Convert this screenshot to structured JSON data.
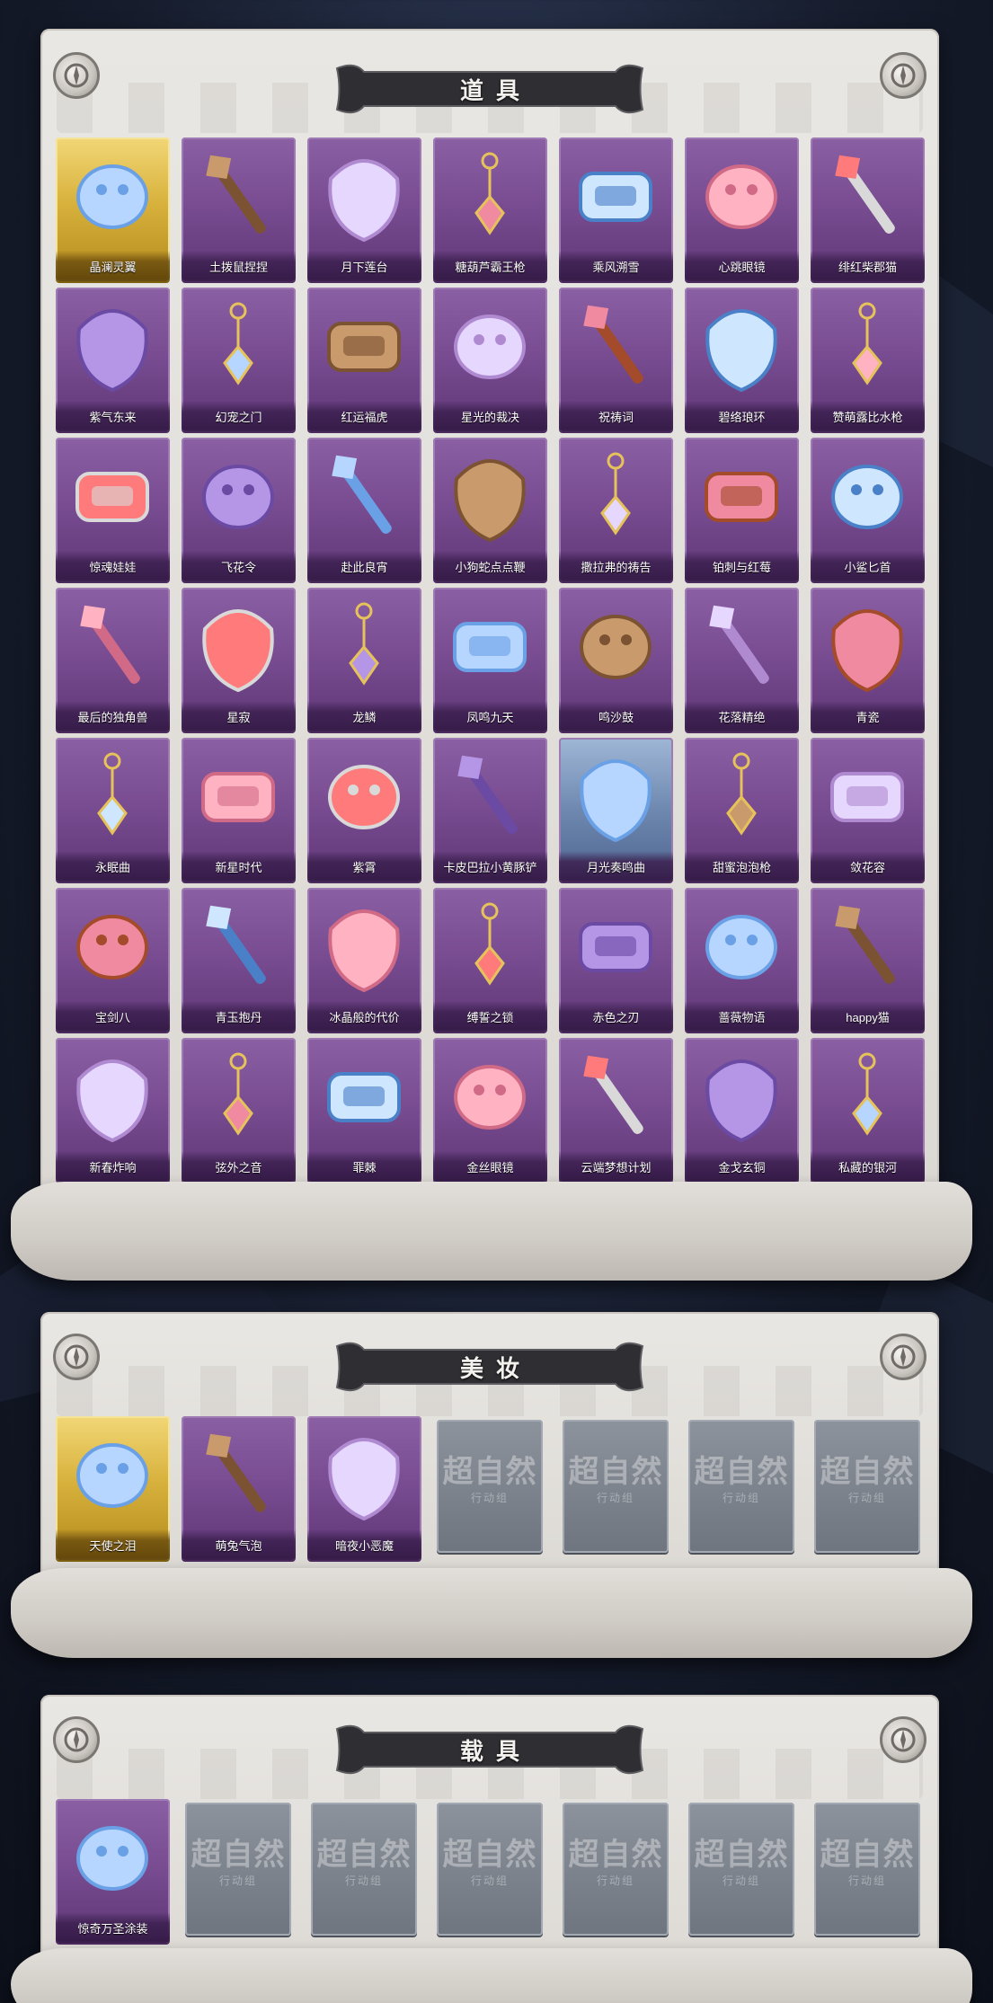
{
  "sections": {
    "props": {
      "title": "道具",
      "items": [
        {
          "label": "晶澜灵翼",
          "rarity": "gold",
          "icon": "crystal-wings-icon"
        },
        {
          "label": "土拨鼠捏捏",
          "rarity": "purple",
          "icon": "marmot-plush-icon"
        },
        {
          "label": "月下莲台",
          "rarity": "purple",
          "icon": "lotus-pendant-icon"
        },
        {
          "label": "糖葫芦霸王枪",
          "rarity": "purple",
          "icon": "candy-spear-icon"
        },
        {
          "label": "乘风溯雪",
          "rarity": "purple",
          "icon": "jetpack-icon"
        },
        {
          "label": "心跳眼镜",
          "rarity": "purple",
          "icon": "heart-glasses-icon"
        },
        {
          "label": "绯红柴郡猫",
          "rarity": "purple",
          "icon": "cheshire-cat-icon"
        },
        {
          "label": "紫气东来",
          "rarity": "purple",
          "icon": "purple-blade-icon"
        },
        {
          "label": "幻宠之门",
          "rarity": "purple",
          "icon": "pet-device-icon"
        },
        {
          "label": "红运福虎",
          "rarity": "purple",
          "icon": "tiger-plush-icon"
        },
        {
          "label": "星光的裁决",
          "rarity": "purple",
          "icon": "star-rifle-icon"
        },
        {
          "label": "祝祷词",
          "rarity": "purple",
          "icon": "cross-necklace-icon"
        },
        {
          "label": "碧络琅环",
          "rarity": "purple",
          "icon": "jade-sword-icon"
        },
        {
          "label": "赞萌露比水枪",
          "rarity": "purple",
          "icon": "water-gun-icon"
        },
        {
          "label": "惊魂娃娃",
          "rarity": "purple",
          "icon": "skull-doll-icon"
        },
        {
          "label": "飞花令",
          "rarity": "purple",
          "icon": "flower-bouquet-icon"
        },
        {
          "label": "赴此良宵",
          "rarity": "purple",
          "icon": "folding-fan-icon"
        },
        {
          "label": "小狗蛇点点鞭",
          "rarity": "purple",
          "icon": "snake-whip-icon"
        },
        {
          "label": "撒拉弗的祷告",
          "rarity": "purple",
          "icon": "holy-staff-icon"
        },
        {
          "label": "铂刺与红莓",
          "rarity": "purple",
          "icon": "thorn-blade-icon"
        },
        {
          "label": "小鲨匕首",
          "rarity": "purple",
          "icon": "shark-dagger-icon"
        },
        {
          "label": "最后的独角兽",
          "rarity": "purple",
          "icon": "unicorn-blade-icon"
        },
        {
          "label": "星寂",
          "rarity": "purple",
          "icon": "star-cannon-icon"
        },
        {
          "label": "龙鳞",
          "rarity": "purple",
          "icon": "golden-shovel-icon"
        },
        {
          "label": "凤鸣九天",
          "rarity": "purple",
          "icon": "phoenix-sword-icon"
        },
        {
          "label": "鸣沙鼓",
          "rarity": "purple",
          "icon": "sand-drum-icon"
        },
        {
          "label": "花落精绝",
          "rarity": "purple",
          "icon": "gold-flower-necklace-icon"
        },
        {
          "label": "青瓷",
          "rarity": "purple",
          "icon": "celadon-knife-icon"
        },
        {
          "label": "永眠曲",
          "rarity": "purple",
          "icon": "violet-sword-icon"
        },
        {
          "label": "新星时代",
          "rarity": "purple",
          "icon": "revolver-icon"
        },
        {
          "label": "紫霄",
          "rarity": "purple",
          "icon": "pendant-chain-icon"
        },
        {
          "label": "卡皮巴拉小黄豚铲",
          "rarity": "purple",
          "icon": "capybara-shovel-icon"
        },
        {
          "label": "月光奏鸣曲",
          "rarity": "blue",
          "icon": "moon-piano-icon"
        },
        {
          "label": "甜蜜泡泡枪",
          "rarity": "purple",
          "icon": "bubble-gun-icon"
        },
        {
          "label": "敛花容",
          "rarity": "purple",
          "icon": "flower-headpiece-icon"
        },
        {
          "label": "宝剑八",
          "rarity": "purple",
          "icon": "heart-shield-icon"
        },
        {
          "label": "青玉抱丹",
          "rarity": "purple",
          "icon": "jade-gourd-icon"
        },
        {
          "label": "冰晶般的代价",
          "rarity": "purple",
          "icon": "ice-lotus-icon"
        },
        {
          "label": "缚誓之锁",
          "rarity": "purple",
          "icon": "chain-key-icon"
        },
        {
          "label": "赤色之刃",
          "rarity": "purple",
          "icon": "red-blade-icon"
        },
        {
          "label": "蔷薇物语",
          "rarity": "purple",
          "icon": "first-aid-case-icon"
        },
        {
          "label": "happy猫",
          "rarity": "purple",
          "icon": "happy-cat-icon"
        },
        {
          "label": "新春炸响",
          "rarity": "purple",
          "icon": "firecracker-icon"
        },
        {
          "label": "弦外之音",
          "rarity": "purple",
          "icon": "pipa-icon"
        },
        {
          "label": "罪棘",
          "rarity": "purple",
          "icon": "thorn-spear-icon"
        },
        {
          "label": "金丝眼镜",
          "rarity": "purple",
          "icon": "gold-glasses-icon"
        },
        {
          "label": "云端梦想计划",
          "rarity": "purple",
          "icon": "dream-wand-icon"
        },
        {
          "label": "金戈玄铜",
          "rarity": "purple",
          "icon": "bronze-grenade-icon"
        },
        {
          "label": "私藏的银河",
          "rarity": "purple",
          "icon": "pink-cloud-icon"
        }
      ]
    },
    "makeup": {
      "title": "美妆",
      "items": [
        {
          "label": "天使之泪",
          "rarity": "gold",
          "icon": "angel-head-icon"
        },
        {
          "label": "萌兔气泡",
          "rarity": "purple",
          "icon": "bunny-head-icon"
        },
        {
          "label": "暗夜小恶魔",
          "rarity": "purple",
          "icon": "devil-head-icon"
        }
      ],
      "locked_count": 4
    },
    "vehicles": {
      "title": "载具",
      "items": [
        {
          "label": "惊奇万圣涂装",
          "rarity": "purple",
          "icon": "halloween-truck-icon"
        }
      ],
      "locked_count": 6
    }
  },
  "locked_watermark": {
    "main": "超自然",
    "sub": "行动组"
  },
  "colors": {
    "purple_card": "#7a4d92",
    "gold_card": "#d8b23d",
    "locked_card": "#6f757f",
    "panel": "#e3e0dc",
    "banner": "#2f2f33"
  }
}
